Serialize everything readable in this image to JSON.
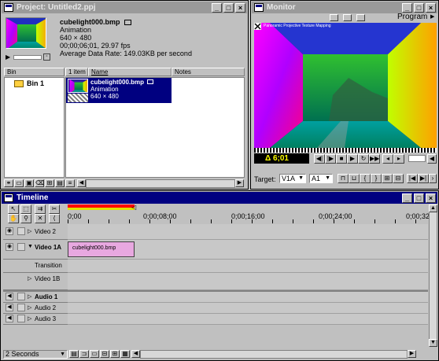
{
  "project": {
    "title": "Project: Untitled2.ppj",
    "clip_name": "cubelight000.bmp",
    "clip_type": "Animation",
    "clip_size": "640 × 480",
    "clip_duration": "00;00;06;01, 29.97 fps",
    "clip_rate": "Average Data Rate: 149.03KB per second",
    "bin_header": "Bin",
    "bin_item": "Bin 1",
    "count_header": "1 item",
    "name_header": "Name",
    "notes_header": "Notes",
    "item_name": "cubelight000.bmp",
    "item_type": "Animation",
    "item_size": "640 × 480"
  },
  "monitor": {
    "title": "Monitor",
    "view_label": "Program",
    "overlay_text": "Panoramic Projective Texture Mapping",
    "timecode": "Δ 6;01",
    "target_label": "Target:",
    "video_target": "V1A",
    "audio_target": "A1"
  },
  "timeline": {
    "title": "Timeline",
    "ruler": [
      "0;00",
      "0;00;08;00",
      "0;00;16;00",
      "0;00;24;00",
      "0;00;32"
    ],
    "tracks": {
      "video2": "Video 2",
      "video1a": "Video 1A",
      "transition": "Transition",
      "video1b": "Video 1B",
      "audio1": "Audio 1",
      "audio2": "Audio 2",
      "audio3": "Audio 3"
    },
    "clip_label": "cubelight000.bmp",
    "zoom": "2 Seconds"
  },
  "colors": {
    "title_active": "#000080",
    "title_inactive": "#9a9a9a",
    "clip_fill": "#e8a8e0",
    "selection": "#000080",
    "timecode_text": "#ffff00"
  }
}
